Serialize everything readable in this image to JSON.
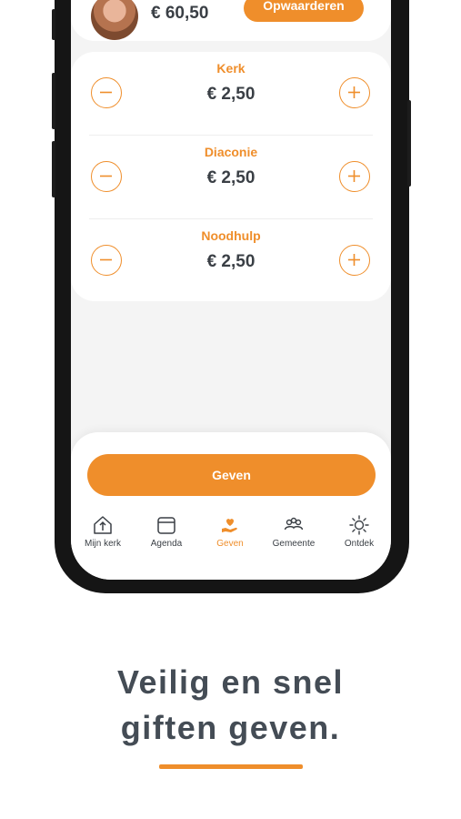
{
  "balance": {
    "amount": "€ 60,50",
    "topup_label": "Opwaarderen"
  },
  "donations": [
    {
      "name": "Kerk",
      "amount": "€ 2,50"
    },
    {
      "name": "Diaconie",
      "amount": "€ 2,50"
    },
    {
      "name": "Noodhulp",
      "amount": "€ 2,50"
    }
  ],
  "give_button_label": "Geven",
  "nav": {
    "items": [
      {
        "label": "Mijn kerk",
        "icon": "home-icon"
      },
      {
        "label": "Agenda",
        "icon": "calendar-icon"
      },
      {
        "label": "Geven",
        "icon": "hand-heart-icon",
        "active": true
      },
      {
        "label": "Gemeente",
        "icon": "people-icon"
      },
      {
        "label": "Ontdek",
        "icon": "sun-icon"
      }
    ]
  },
  "tagline": {
    "line1": "Veilig en snel",
    "line2": "giften geven."
  },
  "colors": {
    "accent": "#ef8e2b",
    "text_dark": "#3a3f45",
    "background": "#f4f4f4"
  }
}
